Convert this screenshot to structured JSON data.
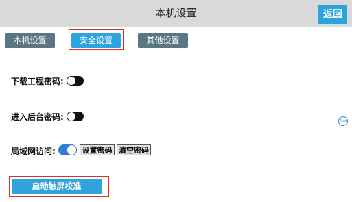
{
  "header": {
    "title": "本机设置",
    "back_label": "返回"
  },
  "tabs": [
    {
      "label": "本机设置",
      "active": false
    },
    {
      "label": "安全设置",
      "active": true
    },
    {
      "label": "其他设置",
      "active": false
    }
  ],
  "settings": {
    "download_password": {
      "label": "下载工程密码:",
      "enabled": false
    },
    "backend_password": {
      "label": "进入后台密码:",
      "enabled": false
    },
    "lan_access": {
      "label": "局域网访问:",
      "enabled": true,
      "set_password_label": "设置密码",
      "clear_password_label": "清空密码"
    }
  },
  "calibration": {
    "label": "启动触屏校准"
  },
  "float_icon": {
    "name": "iPad-icon"
  },
  "colors": {
    "accent": "#2aa5e0",
    "tab_normal": "#5b7683",
    "highlight_border": "#d9302c",
    "toggle_on": "#2e7dd6"
  }
}
